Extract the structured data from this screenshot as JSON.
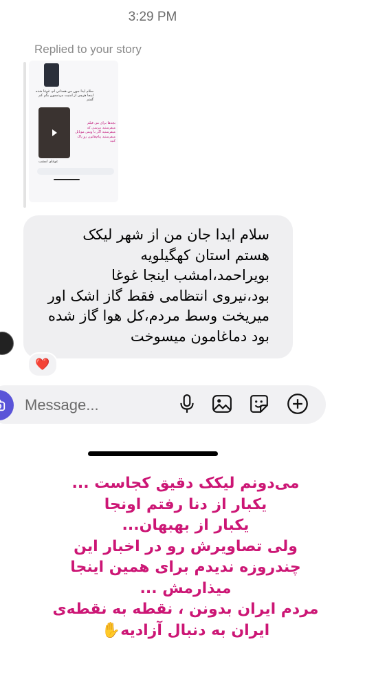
{
  "status": {
    "time": "3:29 PM"
  },
  "reply_label": "Replied to your story",
  "story_preview": {
    "text1": "سلام ایدا جون من همدانی ام، غوغا شده اینجا هرچی از امنیت مردممون بگم کم گفتم",
    "text2": "بچه‌ها برای من فیلم میفرستید مرسی که میفرستید اگر با ویس موبایل میفرستید پیام‌هاتون رو پاک کنید",
    "caption": "غوغای امشب",
    "message_placeholder": "Message..."
  },
  "message": {
    "lines": [
      "سلام ایدا جان من از شهر لیکک",
      "هستم استان کهگیلویه",
      "بویراحمد،امشب اینجا غوغا",
      "بود،نیروی انتظامی فقط گاز اشک اور",
      "میریخت وسط مردم،کل هوا گاز شده",
      "بود دماغامون میسوخت"
    ],
    "reaction": "❤️"
  },
  "composer": {
    "placeholder": "Message...",
    "icons": [
      "camera-icon",
      "microphone-icon",
      "image-icon",
      "sticker-icon",
      "add-icon"
    ],
    "accent": "#5a54d8"
  },
  "caption": {
    "lines": [
      "می‌دونم لیکک دقیق کجاست ...",
      "یکبار از دنا رفتم اونجا",
      "یکبار از بهبهان...",
      "ولی تصاویرش رو در اخبار این",
      "چندروزه ندیدم برای همین اینجا",
      "میذارمش ...",
      "مردم ایران بدونن ، نقطه به نقطه‌ی",
      "ایران به دنبال آزادیه"
    ],
    "end_emoji": "✋",
    "color": "#cc1675"
  }
}
